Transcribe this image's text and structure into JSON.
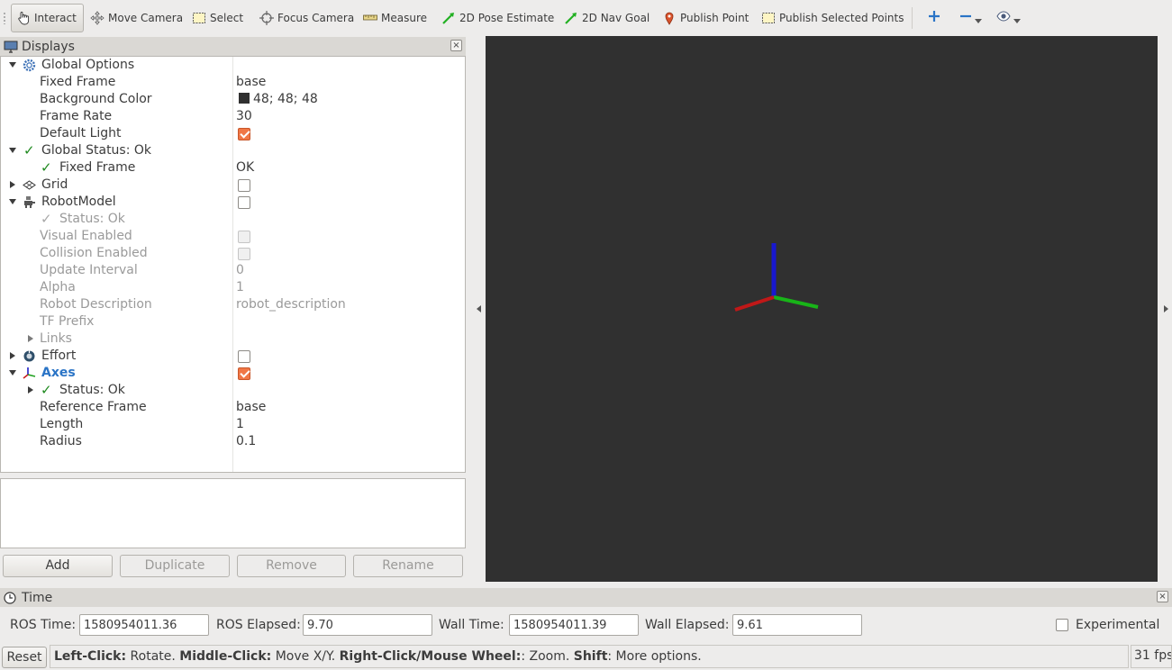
{
  "toolbar": {
    "interact": "Interact",
    "move_camera": "Move Camera",
    "select": "Select",
    "focus_camera": "Focus Camera",
    "measure": "Measure",
    "pose_estimate": "2D Pose Estimate",
    "nav_goal": "2D Nav Goal",
    "publish_point": "Publish Point",
    "publish_selected_points": "Publish Selected Points"
  },
  "displays": {
    "title": "Displays",
    "rows": {
      "global_options": "Global Options",
      "fixed_frame": "Fixed Frame",
      "fixed_frame_val": "base",
      "background_color": "Background Color",
      "background_color_val": "48; 48; 48",
      "frame_rate": "Frame Rate",
      "frame_rate_val": "30",
      "default_light": "Default Light",
      "global_status": "Global Status: Ok",
      "gs_fixed_frame": "Fixed Frame",
      "gs_fixed_frame_val": "OK",
      "grid": "Grid",
      "robot_model": "RobotModel",
      "rm_status": "Status: Ok",
      "visual_enabled": "Visual Enabled",
      "collision_enabled": "Collision Enabled",
      "update_interval": "Update Interval",
      "update_interval_val": "0",
      "alpha": "Alpha",
      "alpha_val": "1",
      "robot_description": "Robot Description",
      "robot_description_val": "robot_description",
      "tf_prefix": "TF Prefix",
      "links": "Links",
      "effort": "Effort",
      "axes": "Axes",
      "axes_status": "Status: Ok",
      "reference_frame": "Reference Frame",
      "reference_frame_val": "base",
      "length": "Length",
      "length_val": "1",
      "radius": "Radius",
      "radius_val": "0.1"
    },
    "buttons": {
      "add": "Add",
      "duplicate": "Duplicate",
      "remove": "Remove",
      "rename": "Rename"
    }
  },
  "time": {
    "title": "Time",
    "ros_time_label": "ROS Time:",
    "ros_time": "1580954011.36",
    "ros_elapsed_label": "ROS Elapsed:",
    "ros_elapsed": "9.70",
    "wall_time_label": "Wall Time:",
    "wall_time": "1580954011.39",
    "wall_elapsed_label": "Wall Elapsed:",
    "wall_elapsed": "9.61",
    "experimental": "Experimental"
  },
  "status": {
    "reset": "Reset",
    "k1": "Left-Click:",
    "t1": " Rotate. ",
    "k2": "Middle-Click:",
    "t2": " Move X/Y. ",
    "k3": "Right-Click/Mouse Wheel:",
    "t3": ": Zoom. ",
    "k4": "Shift",
    "t4": ": More options.",
    "fps": "31 fps"
  },
  "colors": {
    "view_background": "#303030",
    "axis_x": "#c01818",
    "axis_y": "#18b418",
    "axis_z": "#1818d0",
    "checkbox_on": "#f07746",
    "selected_text": "#2a74c6"
  }
}
